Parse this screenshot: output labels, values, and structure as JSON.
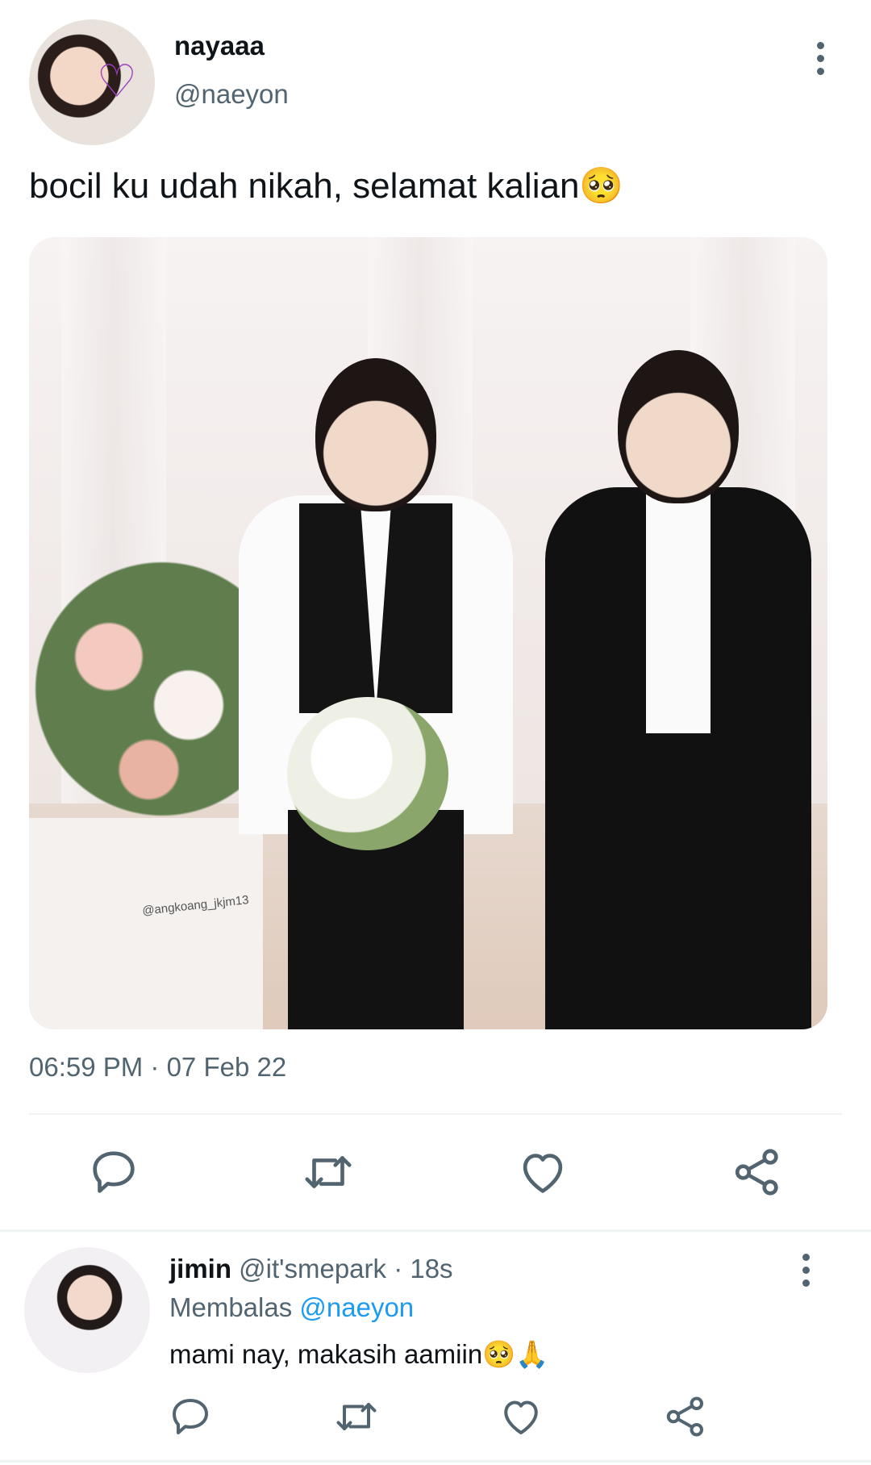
{
  "tweet": {
    "display_name": "nayaaa",
    "handle": "@naeyon",
    "text": "bocil ku udah nikah, selamat kalian🥺",
    "media_watermark": "@angkoang_jkjm13",
    "timestamp": "06:59 PM · 07 Feb 22",
    "actions": [
      "reply-icon",
      "retweet-icon",
      "like-icon",
      "share-icon"
    ],
    "avatar_glyph": "♡"
  },
  "reply": {
    "display_name": "jimin",
    "meta": " @it'smepark · 18s",
    "replying_label": "Membalas ",
    "replying_mention": "@naeyon",
    "text": "mami nay, makasih aamiin🥺🙏",
    "actions": [
      "reply-icon",
      "retweet-icon",
      "like-icon",
      "share-icon"
    ]
  },
  "colors": {
    "text": "#0f1419",
    "secondary": "#536471",
    "link": "#1d9bf0",
    "divider": "#eff3f4"
  }
}
